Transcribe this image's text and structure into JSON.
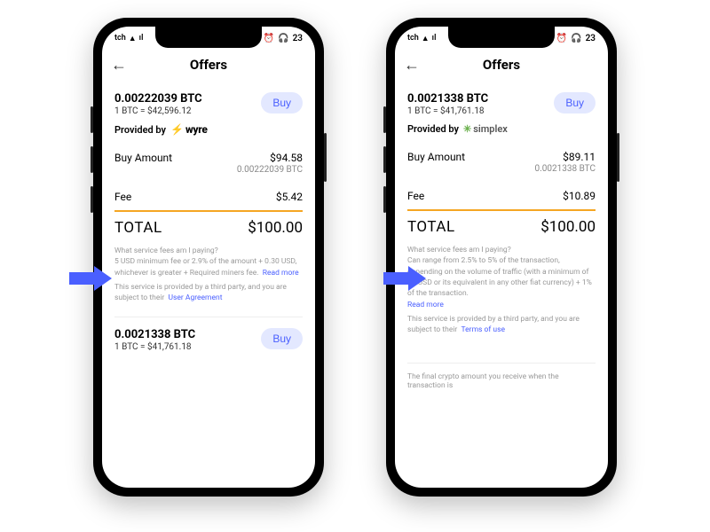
{
  "status": {
    "left_text": "tch",
    "time": "23"
  },
  "header": {
    "title": "Offers"
  },
  "buy_label": "Buy",
  "provided_label": "Provided by",
  "labels": {
    "buy_amount": "Buy Amount",
    "fee": "Fee",
    "total": "TOTAL",
    "read_more": "Read more"
  },
  "phone1": {
    "offer1": {
      "amount": "0.00222039 BTC",
      "rate": "1 BTC = $42,596.12",
      "provider": "wyre",
      "buy_amount_usd": "$94.58",
      "buy_amount_btc": "0.00222039 BTC",
      "fee": "$5.42",
      "total": "$100.00",
      "fine_q": "What service fees am I paying?",
      "fine_1": "5 USD minimum fee or 2.9% of the amount + 0.30 USD, whichever is greater + Required miners fee.",
      "fine_2": "This service is provided by a third party, and you are subject to their",
      "fine_link": "User Agreement"
    },
    "offer2": {
      "amount": "0.0021338 BTC",
      "rate": "1 BTC = $41,761.18"
    }
  },
  "phone2": {
    "offer1": {
      "amount": "0.0021338 BTC",
      "rate": "1 BTC = $41,761.18",
      "provider": "simplex",
      "buy_amount_usd": "$89.11",
      "buy_amount_btc": "0.0021338 BTC",
      "fee": "$10.89",
      "total": "$100.00",
      "fine_q": "What service fees am I paying?",
      "fine_1": "Can range from 2.5% to 5% of the transaction, depending on the volume of traffic (with a minimum of 10 USD or its equivalent in any other fiat currency) + 1% of the transaction.",
      "fine_2": "This service is provided by a third party, and you are subject to their",
      "fine_link": "Terms of use"
    },
    "footnote": "The final crypto amount you receive when the transaction is"
  }
}
